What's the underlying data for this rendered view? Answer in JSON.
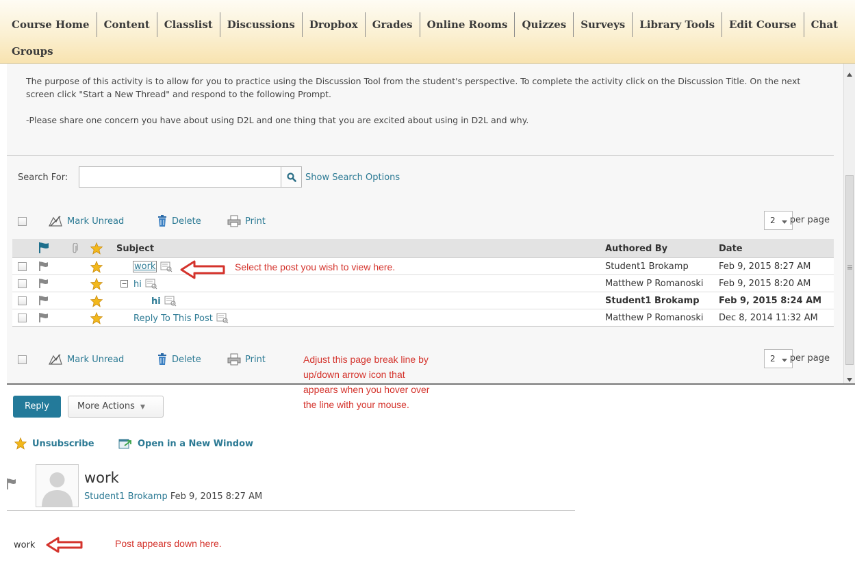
{
  "nav": {
    "items": [
      "Course Home",
      "Content",
      "Classlist",
      "Discussions",
      "Dropbox",
      "Grades",
      "Online Rooms",
      "Quizzes",
      "Surveys",
      "Library Tools",
      "Edit Course",
      "Chat"
    ],
    "second_row": "Groups"
  },
  "description": {
    "paragraph1": "The purpose of this activity is to allow for you to practice using the Discussion Tool from the student's perspective.  To complete the activity click on the Discussion Title.  On the next screen click \"Start a New Thread\" and respond to the following Prompt.",
    "paragraph2": "-Please share one concern you have about using D2L and one thing that you are excited about using in D2L and why."
  },
  "search": {
    "label": "Search For:",
    "value": "",
    "options_link": "Show Search Options"
  },
  "toolbar": {
    "mark_unread": "Mark Unread",
    "delete": "Delete",
    "print": "Print",
    "per_page_value": "2",
    "per_page_label": "per page"
  },
  "table": {
    "headers": {
      "subject": "Subject",
      "authored_by": "Authored By",
      "date": "Date"
    },
    "rows": [
      {
        "subject": "work",
        "author": "Student1 Brokamp",
        "date": "Feb 9, 2015 8:27 AM"
      },
      {
        "subject": "hi",
        "author": "Matthew P Romanoski",
        "date": "Feb 9, 2015 8:20 AM"
      },
      {
        "subject": "hi",
        "author": "Student1 Brokamp",
        "date": "Feb 9, 2015 8:24 AM"
      },
      {
        "subject": "Reply To This Post",
        "author": "Matthew P Romanoski",
        "date": "Dec 8, 2014 11:32 AM"
      }
    ]
  },
  "actions": {
    "reply": "Reply",
    "more_actions": "More Actions",
    "unsubscribe": "Unsubscribe",
    "open_new_window": "Open in a New Window"
  },
  "post": {
    "title": "work",
    "author": "Student1 Brokamp",
    "date": "Feb 9, 2015 8:27 AM",
    "body": "work"
  },
  "annotations": {
    "select_post": "Select the post you wish to view here.",
    "page_break_1": "Adjust this page break line by",
    "page_break_2": "up/down arrow icon that",
    "page_break_3": "appears when you hover over",
    "page_break_4": "the line with your mouse.",
    "post_here": "Post appears down here."
  },
  "colors": {
    "accent": "#2c7a94",
    "reply_button": "#237a9a",
    "annotation": "#d4332c",
    "star": "#f2b81c"
  }
}
